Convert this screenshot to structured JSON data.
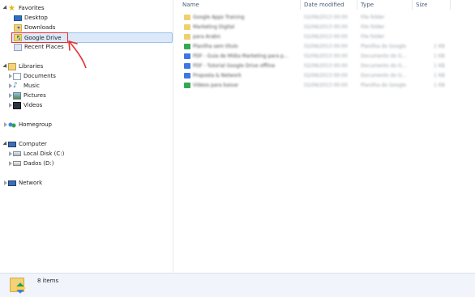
{
  "nav": {
    "favorites": "Favorites",
    "desktop": "Desktop",
    "downloads": "Downloads",
    "google_drive": "Google Drive",
    "recent_places": "Recent Places",
    "libraries": "Libraries",
    "documents": "Documents",
    "music": "Music",
    "pictures": "Pictures",
    "videos": "Videos",
    "homegroup": "Homegroup",
    "computer": "Computer",
    "local_disk": "Local Disk (C:)",
    "dados": "Dados (D:)",
    "network": "Network"
  },
  "columns": {
    "name": "Name",
    "date_modified": "Date modified",
    "type": "Type",
    "size": "Size"
  },
  "files": [
    {
      "kind": "folder",
      "name": "Google Apps Training",
      "date": "02/06/2013 00:00",
      "type": "File folder",
      "size": ""
    },
    {
      "kind": "folder",
      "name": "Marketing Digital",
      "date": "02/06/2013 00:00",
      "type": "File folder",
      "size": ""
    },
    {
      "kind": "folder",
      "name": "para Arabic",
      "date": "02/06/2013 00:00",
      "type": "File folder",
      "size": ""
    },
    {
      "kind": "sheet",
      "name": "Planilha sem título",
      "date": "02/06/2013 00:00",
      "type": "Planilha do Google",
      "size": "1 KB"
    },
    {
      "kind": "doc",
      "name": "PDF - Guia de Mídia Marketing para p...",
      "date": "02/06/2013 00:00",
      "type": "Documento do G...",
      "size": "1 KB"
    },
    {
      "kind": "doc",
      "name": "PDF - Tutorial Google Drive offline",
      "date": "02/06/2013 00:00",
      "type": "Documento do G...",
      "size": "1 KB"
    },
    {
      "kind": "doc",
      "name": "Proposta & Network",
      "date": "02/06/2013 00:00",
      "type": "Documento do G...",
      "size": "1 KB"
    },
    {
      "kind": "sheet",
      "name": "Vídeos para baixar",
      "date": "02/06/2013 00:00",
      "type": "Planilha do Google",
      "size": "1 KB"
    }
  ],
  "status": {
    "item_count": "8 items"
  }
}
